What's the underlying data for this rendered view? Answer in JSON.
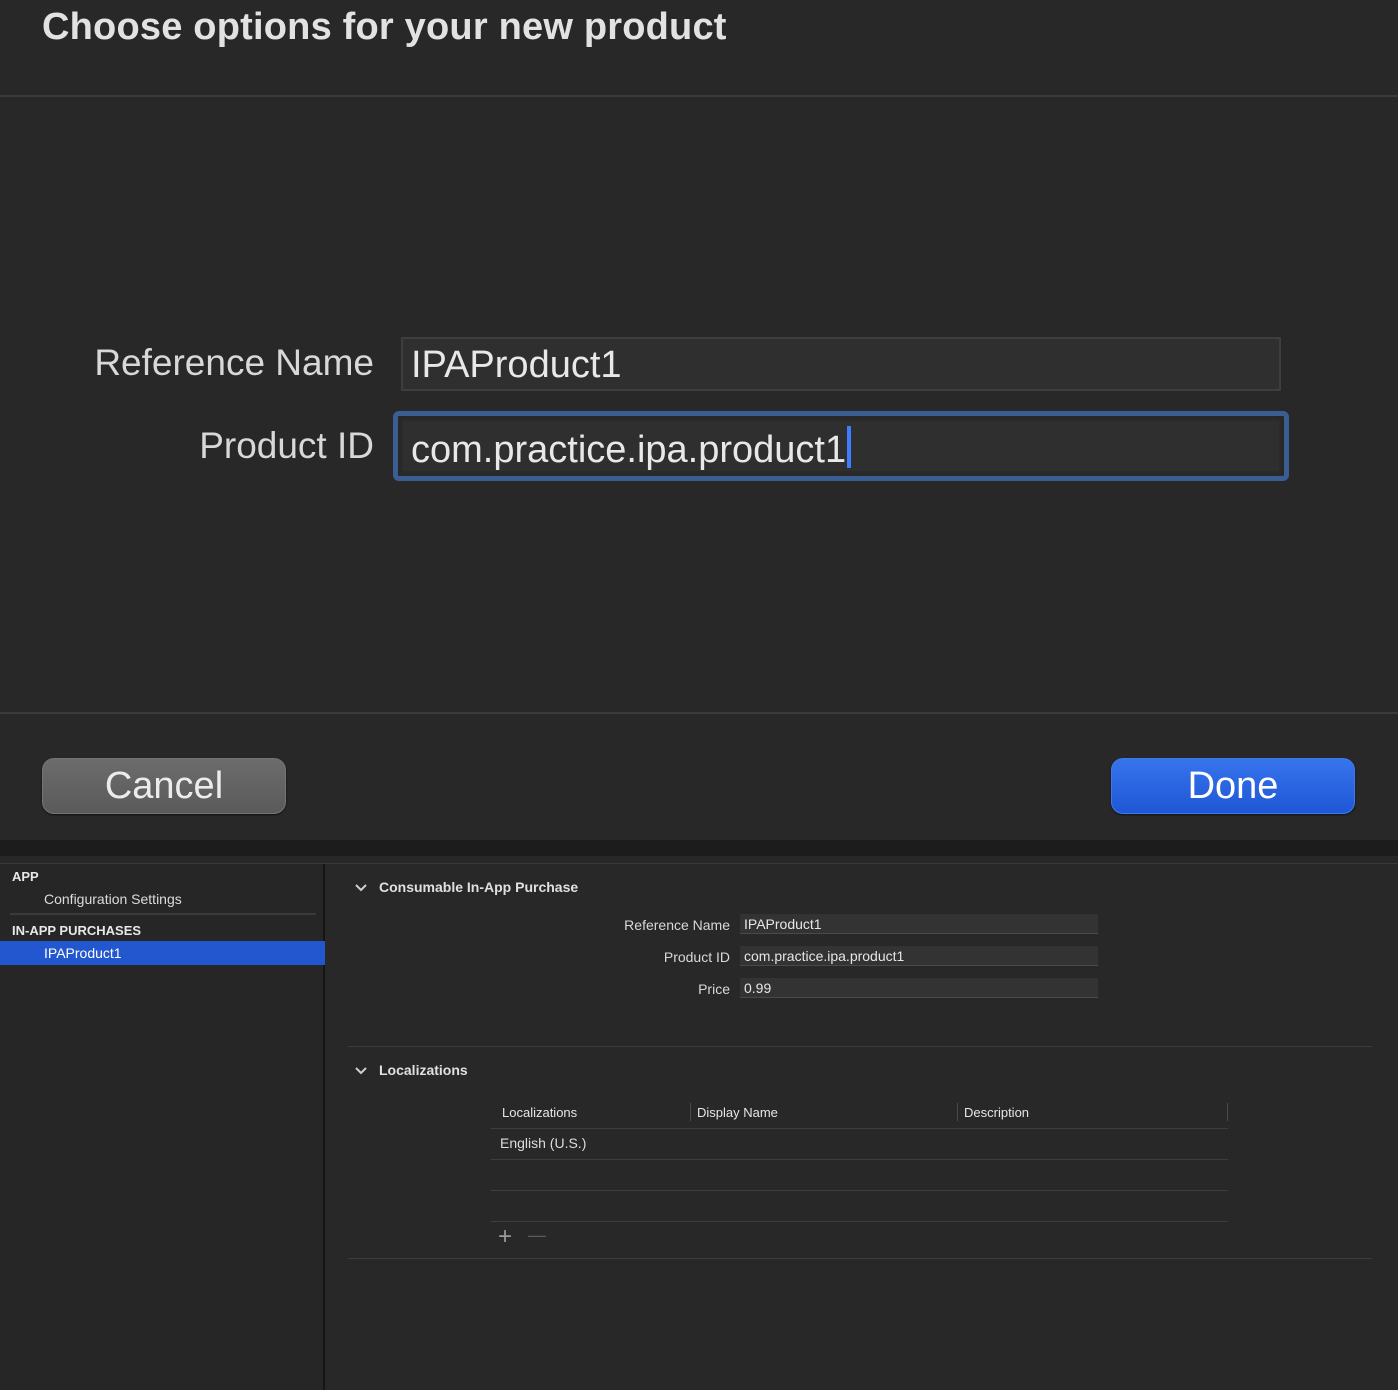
{
  "dialog": {
    "title": "Choose options for your new product",
    "reference_name_label": "Reference Name",
    "reference_name_value": "IPAProduct1",
    "product_id_label": "Product ID",
    "product_id_value": "com.practice.ipa.product1",
    "cancel_label": "Cancel",
    "done_label": "Done"
  },
  "sidebar": {
    "app_header": "APP",
    "app_items": [
      "Configuration Settings"
    ],
    "iap_header": "IN-APP PURCHASES",
    "iap_items": [
      "IPAProduct1"
    ]
  },
  "editor": {
    "purchase_section": "Consumable In-App Purchase",
    "properties": [
      {
        "label": "Reference Name",
        "value": "IPAProduct1"
      },
      {
        "label": "Product ID",
        "value": "com.practice.ipa.product1"
      },
      {
        "label": "Price",
        "value": "0.99"
      }
    ],
    "localizations_section": "Localizations",
    "table": {
      "columns": [
        "Localizations",
        "Display Name",
        "Description"
      ],
      "rows": [
        [
          "English (U.S.)",
          "",
          ""
        ]
      ],
      "add_symbol": "+",
      "remove_symbol": "—"
    }
  },
  "icons": {
    "chevron": "chevron-down-icon",
    "add": "plus-icon",
    "remove": "minus-icon"
  },
  "colors": {
    "accent": "#2257cf",
    "focus_ring": "#3a5e92",
    "background": "#282828"
  }
}
